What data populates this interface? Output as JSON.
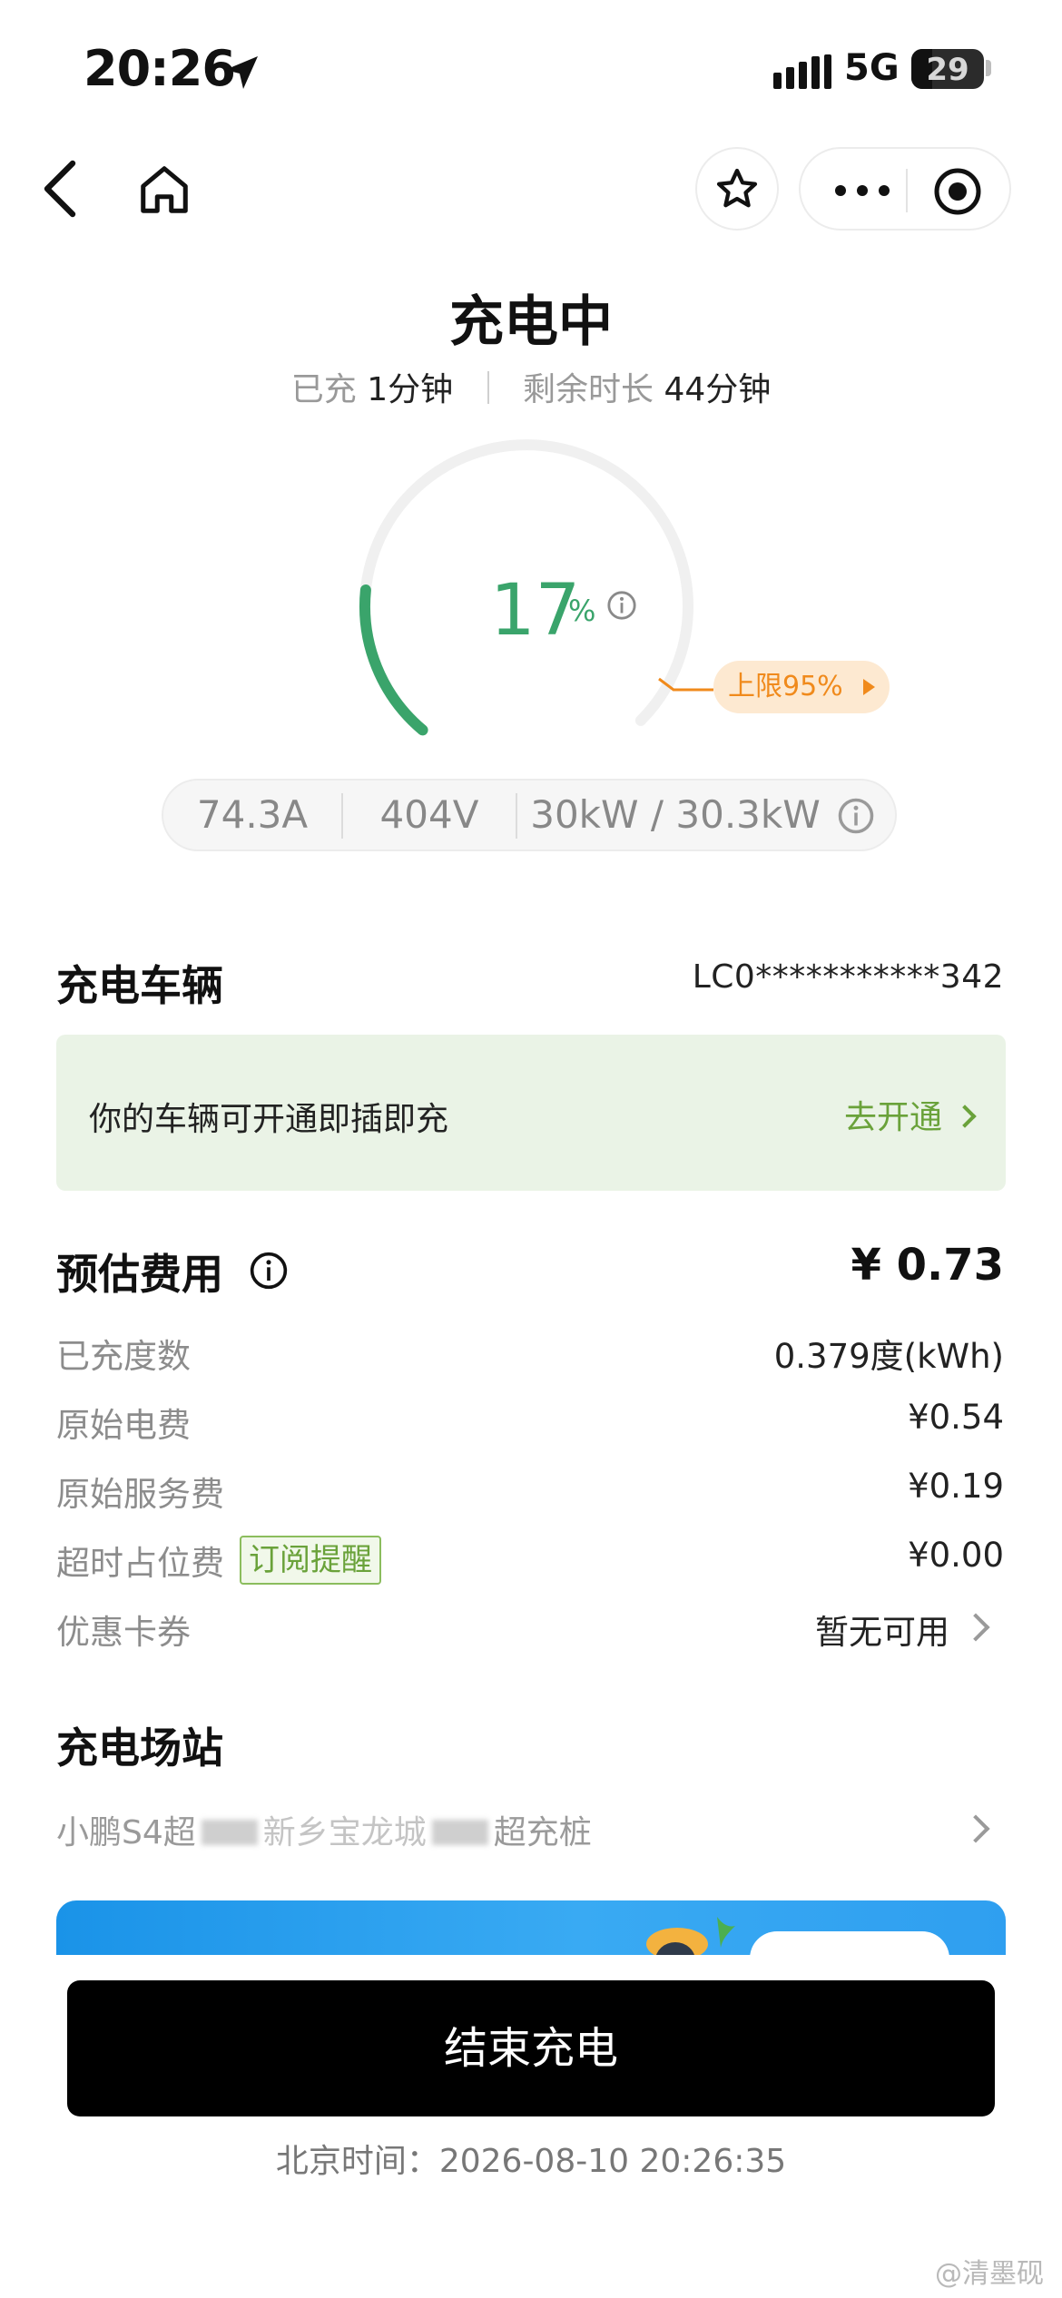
{
  "status_bar": {
    "time": "20:26",
    "network": "5G",
    "battery": "29"
  },
  "header": {
    "title": "充电中"
  },
  "progress": {
    "charged_label": "已充",
    "charged_value": "1分钟",
    "remaining_label": "剩余时长",
    "remaining_value": "44分钟",
    "percent": "17",
    "percent_sign": "%",
    "limit": "上限95%"
  },
  "metrics": {
    "current": "74.3A",
    "voltage": "404V",
    "power": "30kW / 30.3kW"
  },
  "vehicle": {
    "title": "充电车辆",
    "vin": "LC0***********342",
    "banner_text": "你的车辆可开通即插即充",
    "banner_link": "去开通"
  },
  "fee": {
    "title": "预估费用",
    "total": "¥ 0.73",
    "rows": [
      {
        "label": "已充度数",
        "value": "0.379度(kWh)"
      },
      {
        "label": "原始电费",
        "value": "¥0.54"
      },
      {
        "label": "原始服务费",
        "value": "¥0.19"
      },
      {
        "label": "超时占位费",
        "value": "¥0.00",
        "tag": "订阅提醒"
      },
      {
        "label": "优惠卡券",
        "value": "暂无可用"
      }
    ]
  },
  "station": {
    "title": "充电场站",
    "name_start": "小鹏S4超",
    "name_mid": "新乡宝龙城",
    "name_end": "超充桩"
  },
  "actions": {
    "end_charging": "结束充电"
  },
  "footer": {
    "beijing_time": "北京时间：2026-08-10 20:26:35",
    "watermark": "@清墨砚"
  },
  "colors": {
    "accent_green": "#3aa46b",
    "limit_orange": "#f08a1c",
    "banner_bg": "#eaf3e6"
  }
}
